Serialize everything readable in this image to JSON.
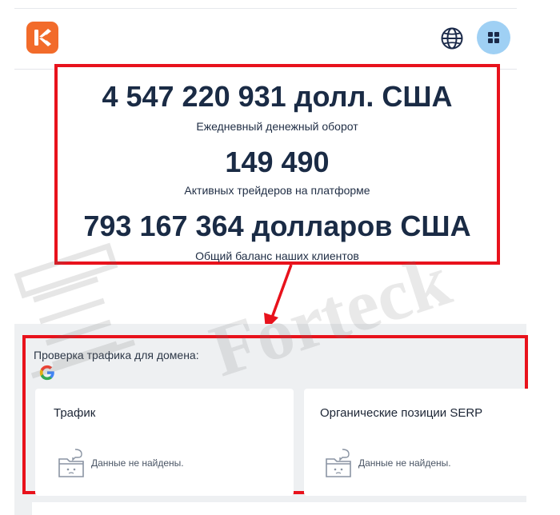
{
  "header": {
    "logo_icon": "forteck-k-logo",
    "globe_icon": "globe-icon",
    "apps_icon": "apps-grid-icon",
    "accent": "#f26b2a"
  },
  "stats": [
    {
      "value": "4 547 220 931 долл. США",
      "label": "Ежедневный денежный оборот"
    },
    {
      "value": "149 490",
      "label": "Активных трейдеров на платформе"
    },
    {
      "value": "793 167 364 долларов США",
      "label": "Общий баланс наших клиентов"
    }
  ],
  "traffic": {
    "title": "Проверка трафика для домена:",
    "cards": [
      {
        "title": "Трафик",
        "empty": "Данные не найдены."
      },
      {
        "title": "Органические позиции SERP",
        "empty": "Данные не найдены."
      }
    ]
  },
  "watermark": {
    "text": "Forteck"
  },
  "colors": {
    "highlight_border": "#e8121c",
    "panel": "#eef0f2"
  }
}
